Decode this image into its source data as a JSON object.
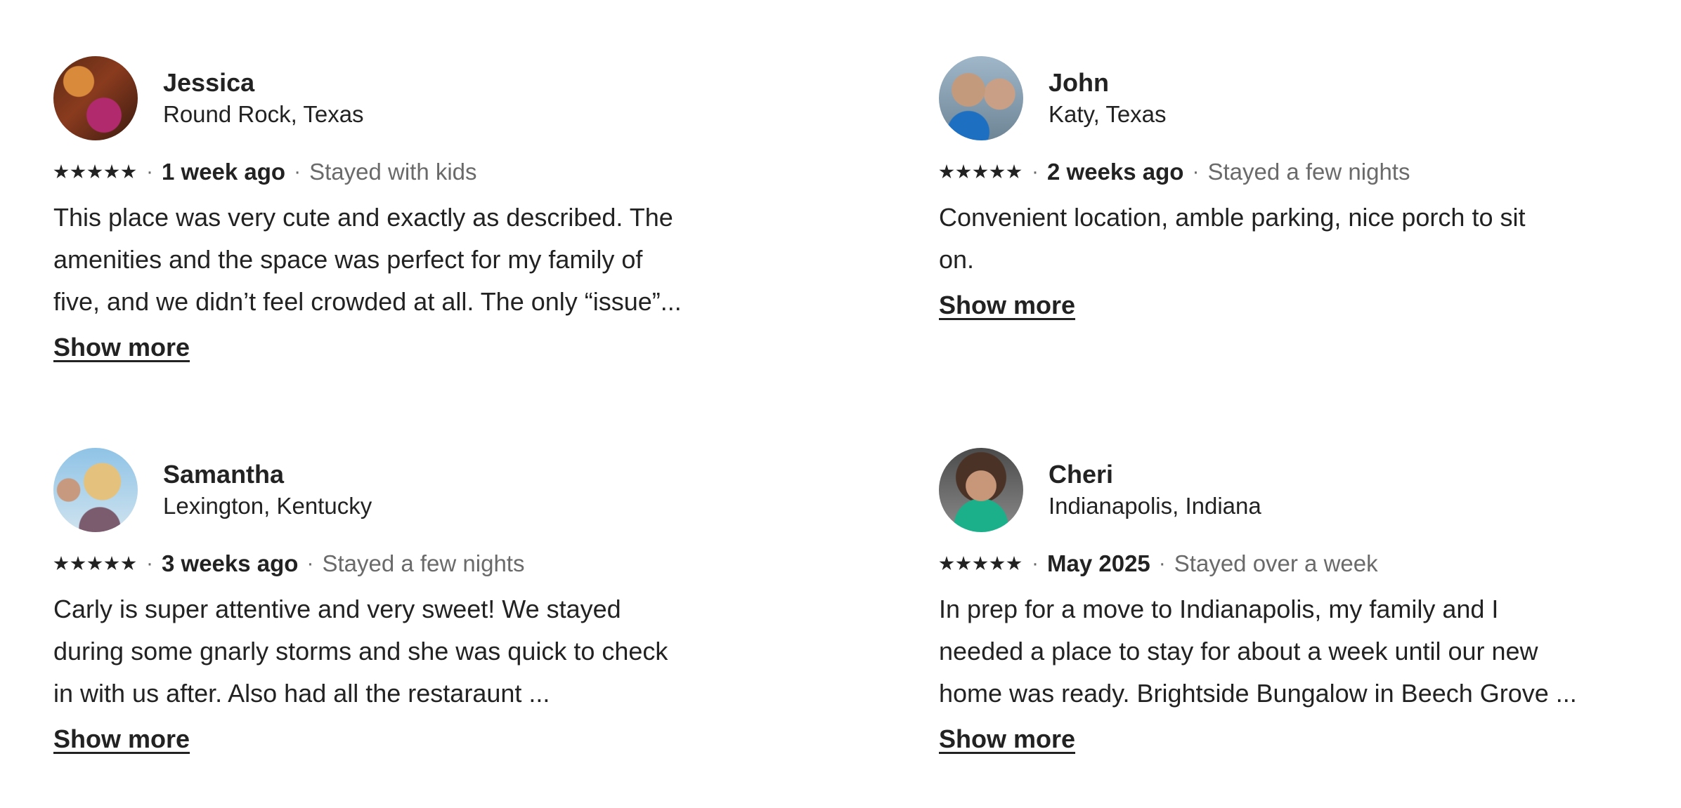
{
  "reviews": [
    {
      "name": "Jessica",
      "location": "Round Rock, Texas",
      "rating": 5,
      "when": "1 week ago",
      "stay": "Stayed with kids",
      "lines": [
        "This place was very cute and exactly as described. The",
        "amenities and the space was perfect for my family of",
        "five, and we didn’t feel crowded at all. The only “issue”..."
      ],
      "show_more": "Show more"
    },
    {
      "name": "John",
      "location": "Katy, Texas",
      "rating": 5,
      "when": "2 weeks ago",
      "stay": "Stayed a few nights",
      "lines": [
        "Convenient location, amble parking, nice porch to sit",
        "on."
      ],
      "show_more": "Show more"
    },
    {
      "name": "Samantha",
      "location": "Lexington, Kentucky",
      "rating": 5,
      "when": "3 weeks ago",
      "stay": "Stayed a few nights",
      "lines": [
        "Carly is super attentive and very sweet! We stayed",
        "during some gnarly storms and she was quick to check",
        "in with us after. Also had all the restaraunt ..."
      ],
      "show_more": "Show more"
    },
    {
      "name": "Cheri",
      "location": "Indianapolis, Indiana",
      "rating": 5,
      "when": "May 2025",
      "stay": "Stayed over a week",
      "lines": [
        "In prep for a move to Indianapolis, my family and I",
        "needed a place to stay for about a week until our new",
        "home was ready. Brightside Bungalow in Beech Grove ..."
      ],
      "show_more": "Show more"
    }
  ]
}
